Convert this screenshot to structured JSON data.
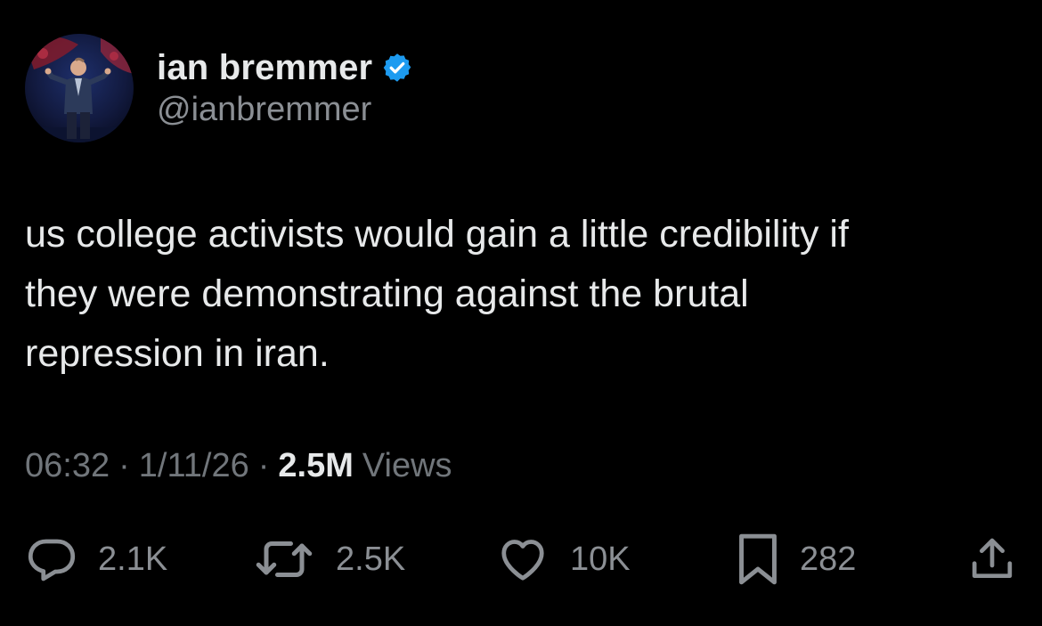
{
  "author": {
    "display_name": "ian bremmer",
    "handle": "@ianbremmer",
    "verified_color": "#1d9bf0"
  },
  "tweet": {
    "text": "us college activists would gain a little credibility if\nthey were demonstrating against the brutal\nrepression in iran.",
    "time": "06:32",
    "date": "1/11/26",
    "separator": "·",
    "views_count": "2.5M",
    "views_label": "Views"
  },
  "actions": {
    "reply": {
      "icon": "reply-icon",
      "count": "2.1K"
    },
    "repost": {
      "icon": "repost-icon",
      "count": "2.5K"
    },
    "like": {
      "icon": "heart-icon",
      "count": "10K"
    },
    "bookmark": {
      "icon": "bookmark-icon",
      "count": "282"
    },
    "share": {
      "icon": "share-icon"
    }
  },
  "colors": {
    "background": "#000000",
    "primary_text": "#e7e9ea",
    "secondary_text": "#71767b",
    "accent": "#1d9bf0"
  }
}
